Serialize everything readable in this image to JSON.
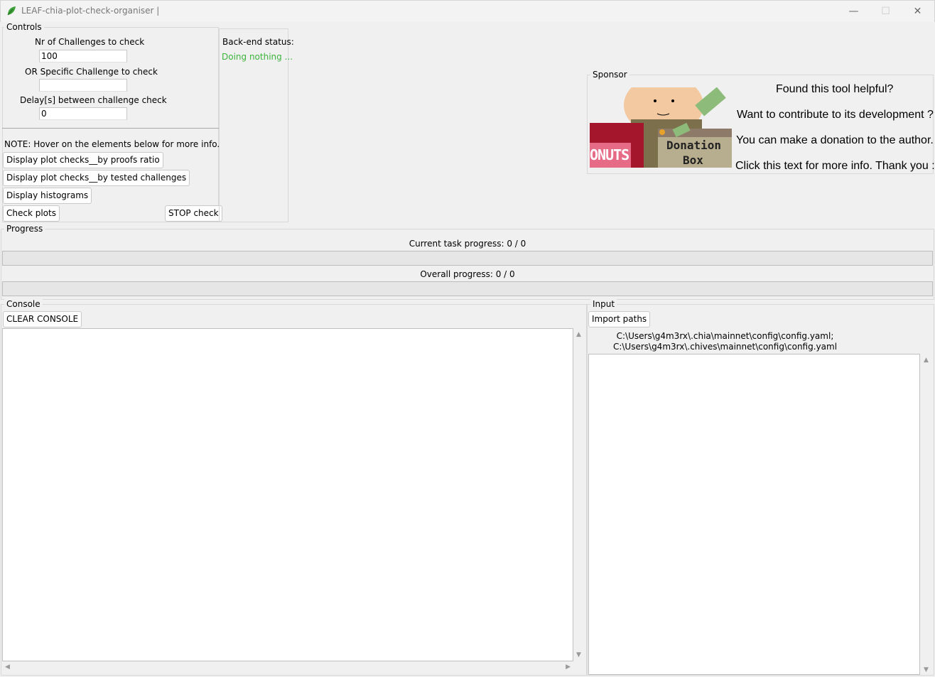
{
  "window": {
    "title": "LEAF-chia-plot-check-organiser |",
    "minimize": "—",
    "maximize": "☐",
    "close": "✕"
  },
  "controls": {
    "frame_label": "Controls",
    "nr_challenges_label": "Nr of Challenges to check",
    "nr_challenges_value": "100",
    "specific_challenge_label": "OR Specific Challenge to check",
    "specific_challenge_value": "",
    "delay_label": "Delay[s] between challenge check",
    "delay_value": "0",
    "note": "NOTE: Hover on the elements below for more info.",
    "btn_proofs_ratio": "Display plot checks__by proofs ratio",
    "btn_tested_challenges": "Display plot checks__by tested challenges",
    "btn_histograms": "Display histograms",
    "btn_check_plots": "Check plots",
    "btn_stop_check": "STOP check"
  },
  "backend": {
    "label": "Back-end status:",
    "status": "Doing nothing ...",
    "status_color": "#3cb43c"
  },
  "sponsor": {
    "frame_label": "Sponsor",
    "image_text_1": "ONUTS",
    "image_text_2": "Donation",
    "image_text_3": "Box",
    "line1": "Found this tool helpful?",
    "line2": "Want to contribute to its development ?",
    "line3": "You can make a donation to the author.",
    "line4": "Click this text for more info. Thank you :)"
  },
  "progress": {
    "frame_label": "Progress",
    "current_label": "Current task progress: 0 / 0",
    "current_fraction": 0,
    "overall_label": "Overall progress: 0 / 0",
    "overall_fraction": 0
  },
  "console": {
    "frame_label": "Console",
    "clear_button": "CLEAR CONSOLE",
    "content": ""
  },
  "input": {
    "frame_label": "Input",
    "import_button": "Import paths",
    "path1": "C:\\Users\\g4m3rx\\.chia\\mainnet\\config\\config.yaml;",
    "path2": "C:\\Users\\g4m3rx\\.chives\\mainnet\\config\\config.yaml",
    "content": ""
  }
}
